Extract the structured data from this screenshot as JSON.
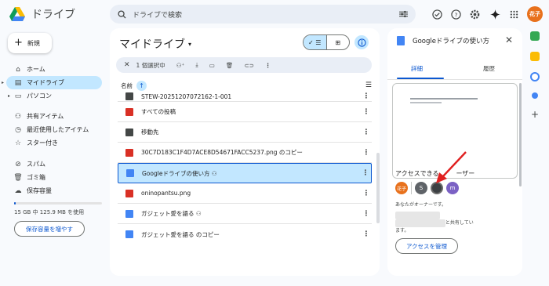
{
  "header": {
    "app_name": "ドライブ",
    "search_placeholder": "ドライブで検索",
    "user_avatar": "花子"
  },
  "nav": {
    "new_label": "新規",
    "items": [
      {
        "label": "ホーム",
        "icon": "home-icon"
      },
      {
        "label": "マイドライブ",
        "icon": "drive-icon",
        "active": true
      },
      {
        "label": "パソコン",
        "icon": "computer-icon"
      },
      {
        "label": "共有アイテム",
        "icon": "people-icon"
      },
      {
        "label": "最近使用したアイテム",
        "icon": "clock-icon"
      },
      {
        "label": "スター付き",
        "icon": "star-icon"
      },
      {
        "label": "スパム",
        "icon": "spam-icon"
      },
      {
        "label": "ゴミ箱",
        "icon": "trash-icon"
      },
      {
        "label": "保存容量",
        "icon": "cloud-icon"
      }
    ],
    "storage_text": "15 GB 中 125.9 MB を使用",
    "storage_used_fraction": 0.008,
    "buy_storage_label": "保存容量を増やす"
  },
  "main": {
    "title": "マイドライブ",
    "selection_text": "1 個選択中",
    "column_name": "名前",
    "files": [
      {
        "name": "STEW-20251207072162-1-001",
        "type": "folder-dark"
      },
      {
        "name": "すべての投稿",
        "type": "folder-red"
      },
      {
        "name": "移動先",
        "type": "folder-dark"
      },
      {
        "name": "30C7D183C1F4D7ACE8D54671FACC5237.png のコピー",
        "type": "image"
      },
      {
        "name": "Googleドライブの使い方",
        "type": "doc",
        "shared": true,
        "selected": true
      },
      {
        "name": "oninopantsu.png",
        "type": "image"
      },
      {
        "name": "ガジェット愛を語る",
        "type": "doc",
        "shared": true
      },
      {
        "name": "ガジェット愛を語る のコピー",
        "type": "doc"
      }
    ]
  },
  "details": {
    "title": "Googleドライブの使い方",
    "tab_details": "詳細",
    "tab_activity": "履歴",
    "access_title": "アクセスできる",
    "access_title_end": "ーザー",
    "avatars": [
      {
        "label": "花子",
        "color": "#e8711c"
      },
      {
        "label": "S",
        "color": "#5f6368"
      },
      {
        "label": "",
        "color": "#3c4043"
      },
      {
        "label": "m",
        "color": "#7b61c4"
      }
    ],
    "owner_note": "あなたがオーナーです。",
    "shared_note_end": "と共有してい",
    "shared_note_end2": "ます。",
    "manage_label": "アクセスを管理"
  },
  "colors": {
    "accent": "#0b57d0",
    "selected_bg": "#c2e7ff",
    "arrow": "#e02020"
  }
}
